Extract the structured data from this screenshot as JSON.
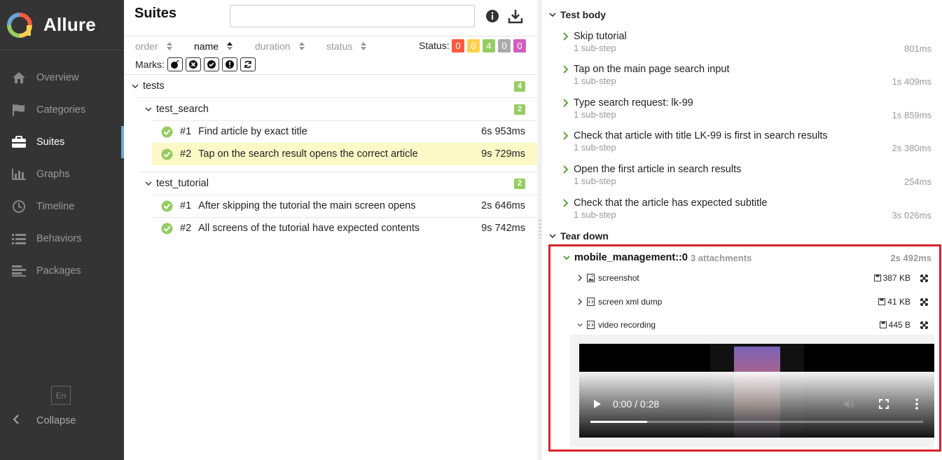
{
  "app": {
    "name": "Allure"
  },
  "sidebar": {
    "items": [
      {
        "label": "Overview",
        "icon": "home-icon"
      },
      {
        "label": "Categories",
        "icon": "flag-icon"
      },
      {
        "label": "Suites",
        "icon": "briefcase-icon",
        "active": true
      },
      {
        "label": "Graphs",
        "icon": "bar-chart-icon"
      },
      {
        "label": "Timeline",
        "icon": "clock-icon"
      },
      {
        "label": "Behaviors",
        "icon": "list-icon"
      },
      {
        "label": "Packages",
        "icon": "align-left-icon"
      }
    ],
    "language": "En",
    "collapse_label": "Collapse"
  },
  "suites": {
    "title": "Suites",
    "search": {
      "value": "",
      "placeholder": ""
    },
    "sort_columns": [
      "order",
      "name",
      "duration",
      "status"
    ],
    "active_sort": "name",
    "status_label": "Status:",
    "status_counts": [
      {
        "value": "0",
        "color": "#fd5a3e"
      },
      {
        "value": "0",
        "color": "#ffd050"
      },
      {
        "value": "4",
        "color": "#97cc64"
      },
      {
        "value": "0",
        "color": "#aaaaaa"
      },
      {
        "value": "0",
        "color": "#d35ebe"
      }
    ],
    "marks_label": "Marks:",
    "marks": [
      "bomb-icon",
      "close-circle-icon",
      "check-circle-icon",
      "exclamation-icon",
      "refresh-icon"
    ],
    "tree": {
      "root": {
        "name": "tests",
        "count": "4"
      },
      "groups": [
        {
          "name": "test_search",
          "count": "2",
          "cases": [
            {
              "num": "#1",
              "name": "Find article by exact title",
              "duration": "6s 953ms"
            },
            {
              "num": "#2",
              "name": "Tap on the search result opens the correct article",
              "duration": "9s 729ms",
              "selected": true
            }
          ]
        },
        {
          "name": "test_tutorial",
          "count": "2",
          "cases": [
            {
              "num": "#1",
              "name": "After skipping the tutorial the main screen opens",
              "duration": "2s 646ms"
            },
            {
              "num": "#2",
              "name": "All screens of the tutorial have expected contents",
              "duration": "9s 742ms"
            }
          ]
        }
      ]
    }
  },
  "details": {
    "test_body_label": "Test body",
    "steps": [
      {
        "title": "Skip tutorial",
        "sub": "1 sub-step",
        "duration": "801ms"
      },
      {
        "title": "Tap on the main page search input",
        "sub": "1 sub-step",
        "duration": "1s 409ms"
      },
      {
        "title": "Type search request: lk-99",
        "sub": "1 sub-step",
        "duration": "1s 859ms"
      },
      {
        "title": "Check that article with title LK-99 is first in search results",
        "sub": "1 sub-step",
        "duration": "2s 380ms"
      },
      {
        "title": "Open the first article in search results",
        "sub": "1 sub-step",
        "duration": "254ms"
      },
      {
        "title": "Check that the article has expected subtitle",
        "sub": "1 sub-step",
        "duration": "3s 026ms"
      }
    ],
    "tear_down_label": "Tear down",
    "fixture": {
      "name": "mobile_management::0",
      "attachments_label": "3 attachments",
      "duration": "2s 492ms"
    },
    "attachments": [
      {
        "name": "screenshot",
        "type_icon": "image-file-icon",
        "size": "387 KB",
        "expanded": false
      },
      {
        "name": "screen xml dump",
        "type_icon": "code-file-icon",
        "size": "41 KB",
        "expanded": false
      },
      {
        "name": "video recording",
        "type_icon": "code-file-icon",
        "size": "445 B",
        "expanded": true
      }
    ],
    "video": {
      "time": "0:00 / 0:28",
      "progress": 0.17
    },
    "highlight_color": "#d9222f"
  }
}
